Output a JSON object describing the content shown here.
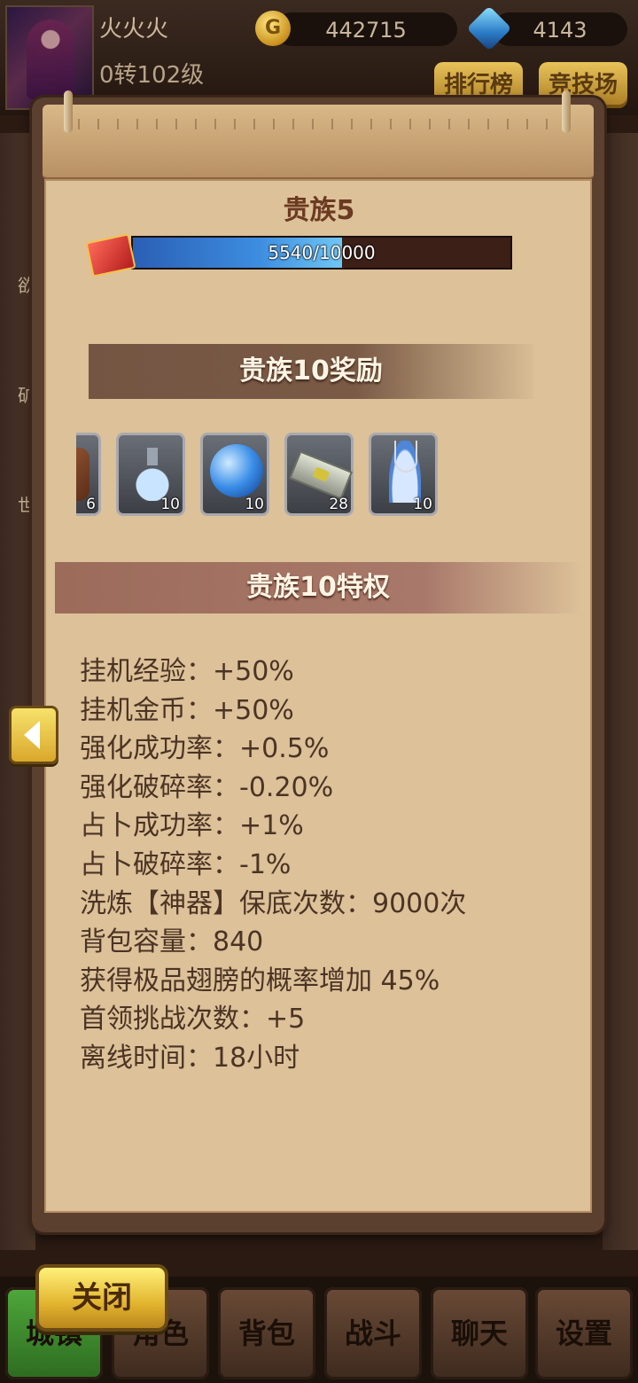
{
  "player": {
    "name": "火火火",
    "level": "0转102级",
    "gold": "442715",
    "gems": "4143"
  },
  "top_buttons": {
    "rank": "排行榜",
    "arena": "竞技场"
  },
  "background_labels": [
    "欲",
    "矿",
    "世"
  ],
  "vip": {
    "current_title": "贵族5",
    "progress_text": "5540/10000",
    "progress_fraction": 0.554
  },
  "rewards": {
    "title": "贵族10奖励",
    "items": [
      {
        "icon": "armor-icon",
        "count": "6"
      },
      {
        "icon": "potion-icon",
        "count": "10"
      },
      {
        "icon": "orb-icon",
        "count": "10"
      },
      {
        "icon": "ticket-icon",
        "count": "28"
      },
      {
        "icon": "necklace-icon",
        "count": "10"
      }
    ]
  },
  "privileges": {
    "title": "贵族10特权",
    "lines": [
      "挂机经验：+50%",
      "挂机金币：+50%",
      "强化成功率：+0.5%",
      "强化破碎率：-0.20%",
      "占卜成功率：+1%",
      "占卜破碎率：-1%",
      "洗炼【神器】保底次数：9000次",
      "背包容量：840",
      "获得极品翅膀的概率增加 45%",
      "首领挑战次数：+5",
      "离线时间：18小时"
    ]
  },
  "close_label": "关闭",
  "nav": [
    "城镇",
    "角色",
    "背包",
    "战斗",
    "聊天",
    "设置"
  ]
}
